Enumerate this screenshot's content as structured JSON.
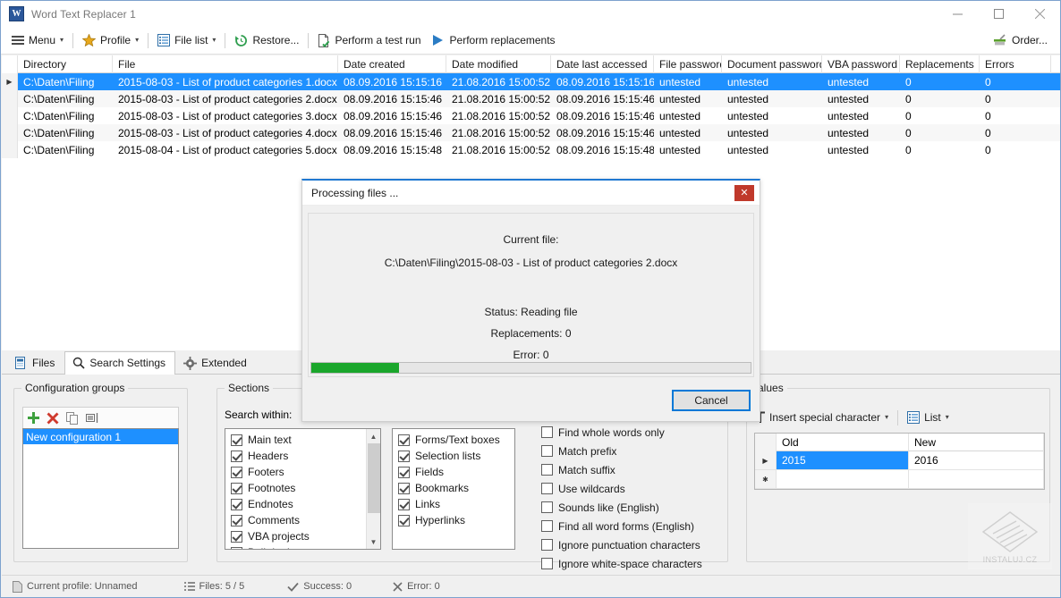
{
  "window": {
    "title": "Word Text Replacer 1",
    "app_icon": "word-document-icon",
    "minimize": "—",
    "maximize": "□",
    "close": "✕"
  },
  "toolbar": {
    "items": [
      {
        "label": "Menu",
        "icon": "hamburger-icon",
        "caret": "▾"
      },
      {
        "label": "Profile",
        "icon": "star-icon",
        "caret": "▾"
      },
      {
        "label": "File list",
        "icon": "list-icon",
        "caret": "▾"
      },
      {
        "label": "Restore...",
        "icon": "restore-clock-icon",
        "caret": ""
      },
      {
        "label": "Perform a test run",
        "icon": "document-check-icon",
        "caret": ""
      },
      {
        "label": "Perform replacements",
        "icon": "play-icon",
        "caret": ""
      }
    ],
    "order": {
      "label": "Order...",
      "icon": "cart-icon"
    }
  },
  "file_grid": {
    "columns": [
      "Directory",
      "File",
      "Date created",
      "Date modified",
      "Date last accessed",
      "File password",
      "Document password",
      "VBA password",
      "Replacements",
      "Errors"
    ],
    "rows": [
      {
        "selected": true,
        "indicator": "▶",
        "cells": [
          "C:\\Daten\\Filing",
          "2015-08-03 - List of product categories 1.docx",
          "08.09.2016 15:15:16",
          "21.08.2016 15:00:52",
          "08.09.2016 15:15:16",
          "untested",
          "untested",
          "untested",
          "0",
          "0"
        ]
      },
      {
        "selected": false,
        "indicator": "",
        "cells": [
          "C:\\Daten\\Filing",
          "2015-08-03 - List of product categories 2.docx",
          "08.09.2016 15:15:46",
          "21.08.2016 15:00:52",
          "08.09.2016 15:15:46",
          "untested",
          "untested",
          "untested",
          "0",
          "0"
        ]
      },
      {
        "selected": false,
        "indicator": "",
        "cells": [
          "C:\\Daten\\Filing",
          "2015-08-03 - List of product categories 3.docx",
          "08.09.2016 15:15:46",
          "21.08.2016 15:00:52",
          "08.09.2016 15:15:46",
          "untested",
          "untested",
          "untested",
          "0",
          "0"
        ]
      },
      {
        "selected": false,
        "indicator": "",
        "cells": [
          "C:\\Daten\\Filing",
          "2015-08-03 - List of product categories 4.docx",
          "08.09.2016 15:15:46",
          "21.08.2016 15:00:52",
          "08.09.2016 15:15:46",
          "untested",
          "untested",
          "untested",
          "0",
          "0"
        ]
      },
      {
        "selected": false,
        "indicator": "",
        "cells": [
          "C:\\Daten\\Filing",
          "2015-08-04 - List of product categories 5.docx",
          "08.09.2016 15:15:48",
          "21.08.2016 15:00:52",
          "08.09.2016 15:15:48",
          "untested",
          "untested",
          "untested",
          "0",
          "0"
        ]
      }
    ]
  },
  "tabs": [
    {
      "label": "Files",
      "icon": "files-icon",
      "active": false
    },
    {
      "label": "Search Settings",
      "icon": "magnifier-icon",
      "active": true
    },
    {
      "label": "Extended",
      "icon": "gear-icon",
      "active": false
    }
  ],
  "config_groups": {
    "legend": "Configuration groups",
    "toolbar": [
      {
        "name": "add-icon",
        "glyph": "+"
      },
      {
        "name": "delete-icon",
        "glyph": "✕"
      },
      {
        "name": "copy-icon",
        "glyph": "❐"
      },
      {
        "name": "rename-icon",
        "glyph": "▤"
      }
    ],
    "items": [
      {
        "label": "New configuration 1",
        "selected": true
      }
    ]
  },
  "sections": {
    "legend": "Sections",
    "search_within_label": "Search within:",
    "column1": [
      {
        "label": "Main text",
        "checked": true
      },
      {
        "label": "Headers",
        "checked": true
      },
      {
        "label": "Footers",
        "checked": true
      },
      {
        "label": "Footnotes",
        "checked": true
      },
      {
        "label": "Endnotes",
        "checked": true
      },
      {
        "label": "Comments",
        "checked": true
      },
      {
        "label": "VBA projects",
        "checked": true
      },
      {
        "label": "Built-in document prope",
        "checked": true
      }
    ],
    "column2": [
      {
        "label": "Forms/Text boxes",
        "checked": true
      },
      {
        "label": "Selection lists",
        "checked": true
      },
      {
        "label": "Fields",
        "checked": true
      },
      {
        "label": "Bookmarks",
        "checked": true
      },
      {
        "label": "Links",
        "checked": true
      },
      {
        "label": "Hyperlinks",
        "checked": true
      }
    ],
    "options": [
      {
        "label": "Find whole words only",
        "checked": false
      },
      {
        "label": "Match prefix",
        "checked": false
      },
      {
        "label": "Match suffix",
        "checked": false
      },
      {
        "label": "Use wildcards",
        "checked": false
      },
      {
        "label": "Sounds like (English)",
        "checked": false
      },
      {
        "label": "Find all word forms (English)",
        "checked": false
      },
      {
        "label": "Ignore punctuation characters",
        "checked": false
      },
      {
        "label": "Ignore white-space characters",
        "checked": false
      }
    ]
  },
  "values_panel": {
    "legend": "alues",
    "toolbar": [
      {
        "label": "Insert special character",
        "icon": "special-character-icon",
        "caret": "▾"
      },
      {
        "label": "List",
        "icon": "list-icon",
        "caret": "▾"
      }
    ],
    "columns": [
      "Old",
      "New"
    ],
    "rows": [
      {
        "indicator": "▶",
        "old": "2015",
        "new": "2016",
        "old_selected": true
      },
      {
        "indicator": "✱",
        "old": "",
        "new": "",
        "old_selected": false
      }
    ]
  },
  "watermark": {
    "text": "INSTALUJ.CZ"
  },
  "statusbar": [
    {
      "label": "Current profile: Unnamed",
      "icon": "document-icon"
    },
    {
      "label": "Files: 5 / 5",
      "icon": "list-icon"
    },
    {
      "label": "Success: 0",
      "icon": "check-icon"
    },
    {
      "label": "Error: 0",
      "icon": "cross-icon"
    }
  ],
  "modal": {
    "title": "Processing files ...",
    "close_glyph": "✕",
    "current_file_label": "Current file:",
    "current_file_path": "C:\\Daten\\Filing\\2015-08-03 - List of product categories 2.docx",
    "status": "Status: Reading file",
    "replacements": "Replacements: 0",
    "error": "Error: 0",
    "progress_percent": 20,
    "cancel_label": "Cancel"
  },
  "colors": {
    "accent_blue": "#1e90ff",
    "progress_green": "#1aa62b",
    "close_red": "#c0392b",
    "focus_blue": "#0078d7"
  }
}
